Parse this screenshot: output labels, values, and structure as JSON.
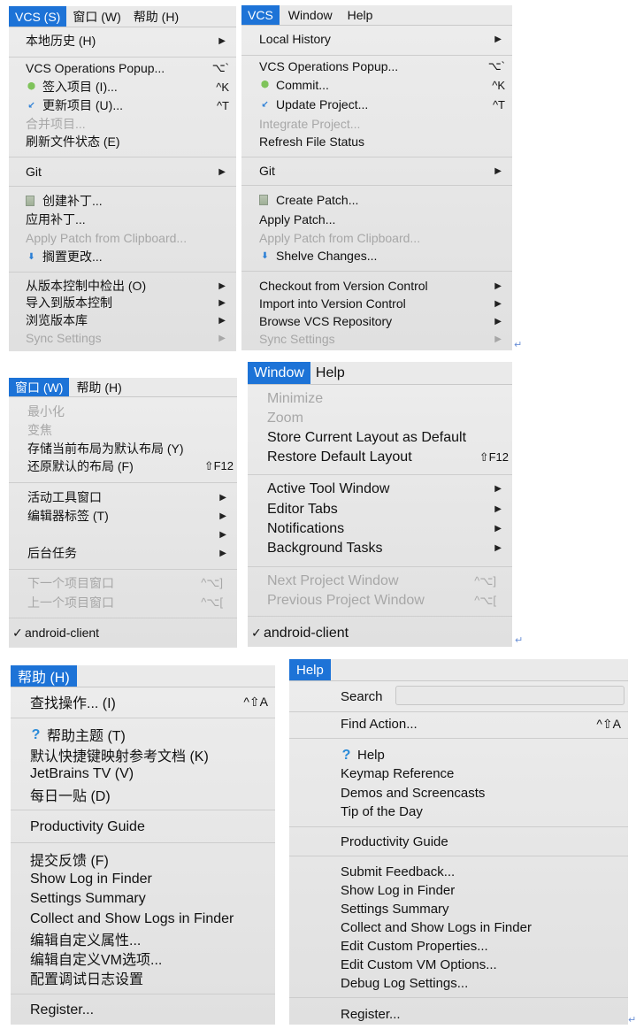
{
  "panel_vcs_cn": {
    "menubar": [
      "VCS (S)",
      "窗口 (W)",
      "帮助 (H)"
    ],
    "items": [
      {
        "label": "本地历史 (H)",
        "submenu": true
      },
      {
        "label": "VCS Operations Popup...",
        "shortcut": "⌥`"
      },
      {
        "label": "签入项目 (I)...",
        "shortcut": "^K",
        "icon": "commit-icon"
      },
      {
        "label": "更新项目 (U)...",
        "shortcut": "^T",
        "icon": "update-icon"
      },
      {
        "label": "合并项目...",
        "disabled": true
      },
      {
        "label": "刷新文件状态 (E)"
      },
      {
        "label": "Git",
        "submenu": true
      },
      {
        "label": "创建补丁...",
        "icon": "patch-icon"
      },
      {
        "label": "应用补丁..."
      },
      {
        "label": "Apply Patch from Clipboard...",
        "disabled": true
      },
      {
        "label": "搁置更改...",
        "icon": "shelve-icon"
      },
      {
        "label": "从版本控制中检出 (O)",
        "submenu": true
      },
      {
        "label": "导入到版本控制",
        "submenu": true
      },
      {
        "label": "浏览版本库",
        "submenu": true
      },
      {
        "label": "Sync Settings",
        "submenu": true,
        "disabled": true
      }
    ]
  },
  "panel_vcs_en": {
    "menubar": [
      "VCS",
      "Window",
      "Help"
    ],
    "items": [
      {
        "label": "Local History",
        "submenu": true
      },
      {
        "label": "VCS Operations Popup...",
        "shortcut": "⌥`"
      },
      {
        "label": "Commit...",
        "shortcut": "^K",
        "icon": "commit-icon"
      },
      {
        "label": "Update Project...",
        "shortcut": "^T",
        "icon": "update-icon"
      },
      {
        "label": "Integrate Project...",
        "disabled": true
      },
      {
        "label": "Refresh File Status"
      },
      {
        "label": "Git",
        "submenu": true
      },
      {
        "label": "Create Patch...",
        "icon": "patch-icon"
      },
      {
        "label": "Apply Patch..."
      },
      {
        "label": "Apply Patch from Clipboard...",
        "disabled": true
      },
      {
        "label": "Shelve Changes...",
        "icon": "shelve-icon"
      },
      {
        "label": "Checkout from Version Control",
        "submenu": true
      },
      {
        "label": "Import into Version Control",
        "submenu": true
      },
      {
        "label": "Browse VCS Repository",
        "submenu": true
      },
      {
        "label": "Sync Settings",
        "submenu": true,
        "disabled": true
      }
    ]
  },
  "panel_window_cn": {
    "menubar": [
      "窗口 (W)",
      "帮助 (H)"
    ],
    "items": [
      {
        "label": "最小化",
        "disabled": true
      },
      {
        "label": "变焦",
        "disabled": true
      },
      {
        "label": "存储当前布局为默认布局 (Y)"
      },
      {
        "label": "还原默认的布局 (F)",
        "shortcut": "⇧F12"
      },
      {
        "label": "活动工具窗口",
        "submenu": true
      },
      {
        "label": "编辑器标签 (T)",
        "submenu": true
      },
      {
        "label": "",
        "submenu": true
      },
      {
        "label": "后台任务",
        "submenu": true
      },
      {
        "label": "下一个项目窗口",
        "shortcut": "^⌥]",
        "disabled": true
      },
      {
        "label": "上一个项目窗口",
        "shortcut": "^⌥[",
        "disabled": true
      },
      {
        "label": "android-client",
        "checked": true
      }
    ]
  },
  "panel_window_en": {
    "menubar": [
      "Window",
      "Help"
    ],
    "items": [
      {
        "label": "Minimize",
        "disabled": true
      },
      {
        "label": "Zoom",
        "disabled": true
      },
      {
        "label": "Store Current Layout as Default"
      },
      {
        "label": "Restore Default Layout",
        "shortcut": "⇧F12"
      },
      {
        "label": "Active Tool Window",
        "submenu": true
      },
      {
        "label": "Editor Tabs",
        "submenu": true
      },
      {
        "label": "Notifications",
        "submenu": true
      },
      {
        "label": "Background Tasks",
        "submenu": true
      },
      {
        "label": "Next Project Window",
        "shortcut": "^⌥]",
        "disabled": true
      },
      {
        "label": "Previous Project Window",
        "shortcut": "^⌥[",
        "disabled": true
      },
      {
        "label": "android-client",
        "checked": true
      }
    ]
  },
  "panel_help_cn": {
    "menubar": [
      "帮助 (H)"
    ],
    "items": [
      {
        "label": "查找操作... (I)",
        "shortcut": "^⇧A"
      },
      {
        "label": "帮助主题 (T)",
        "icon": "help-icon"
      },
      {
        "label": "默认快捷键映射参考文档 (K)"
      },
      {
        "label": "JetBrains TV (V)"
      },
      {
        "label": "每日一贴 (D)"
      },
      {
        "label": "Productivity Guide"
      },
      {
        "label": "提交反馈 (F)"
      },
      {
        "label": "Show Log in Finder"
      },
      {
        "label": "Settings Summary"
      },
      {
        "label": "Collect and Show Logs in Finder"
      },
      {
        "label": "编辑自定义属性..."
      },
      {
        "label": "编辑自定义VM选项..."
      },
      {
        "label": "配置调试日志设置"
      },
      {
        "label": "Register..."
      }
    ]
  },
  "panel_help_en": {
    "menubar": [
      "Help"
    ],
    "search_label": "Search",
    "search_value": "",
    "items": [
      {
        "label": "Find Action...",
        "shortcut": "^⇧A"
      },
      {
        "label": "Help",
        "icon": "help-icon"
      },
      {
        "label": "Keymap Reference"
      },
      {
        "label": "Demos and Screencasts"
      },
      {
        "label": "Tip of the Day"
      },
      {
        "label": "Productivity Guide"
      },
      {
        "label": "Submit Feedback..."
      },
      {
        "label": "Show Log in Finder"
      },
      {
        "label": "Settings Summary"
      },
      {
        "label": "Collect and Show Logs in Finder"
      },
      {
        "label": "Edit Custom Properties..."
      },
      {
        "label": "Edit Custom VM Options..."
      },
      {
        "label": "Debug Log Settings..."
      },
      {
        "label": "Register..."
      }
    ]
  },
  "return_mark": "↵"
}
